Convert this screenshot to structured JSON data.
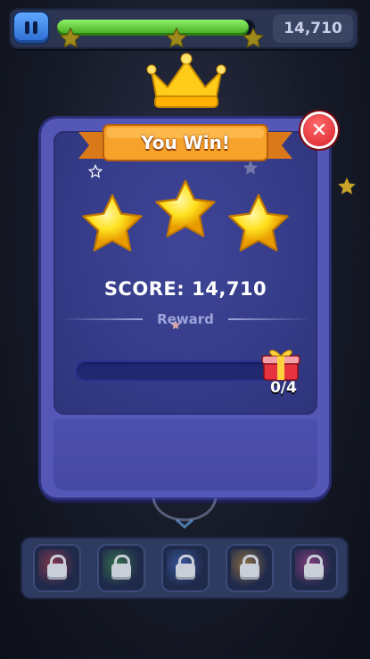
{
  "hud": {
    "score": "14,710",
    "level_progress": 0.97,
    "milestone_stars": 3
  },
  "dialog": {
    "title": "You Win!",
    "stars_earned": 3,
    "score_label": "SCORE:",
    "score_value": "14,710",
    "reward_label": "Reward",
    "reward_progress": 0.0,
    "reward_count": "0/4"
  },
  "boosters": [
    {
      "name": "booster-1",
      "locked": true,
      "color": "#d8434f"
    },
    {
      "name": "booster-2",
      "locked": true,
      "color": "#48a84a"
    },
    {
      "name": "booster-3",
      "locked": true,
      "color": "#4b7ad8"
    },
    {
      "name": "booster-4",
      "locked": true,
      "color": "#e3a23c"
    },
    {
      "name": "booster-5",
      "locked": true,
      "color": "#d64aa5"
    }
  ],
  "colors": {
    "star_gold": "#ffd21f",
    "ribbon_orange": "#f39a1e",
    "progress_green": "#5ccc2f",
    "panel_purple": "#5457b5"
  },
  "icons": {
    "pause": "pause-icon",
    "close": "close-icon",
    "crown": "crown-icon",
    "gift": "gift-icon",
    "lock": "lock-icon"
  }
}
